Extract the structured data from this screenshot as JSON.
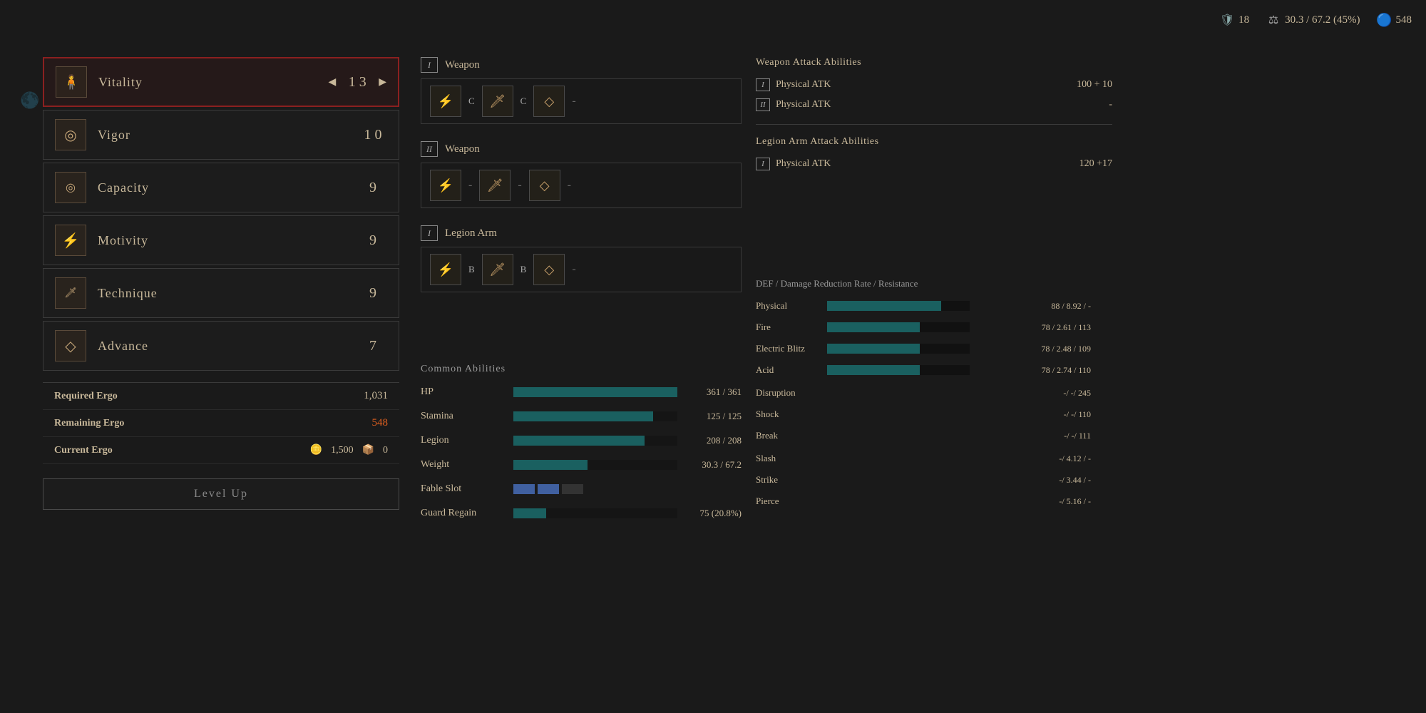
{
  "hud": {
    "shield_value": "18",
    "weight": "30.3 / 67.2 (45%)",
    "ergo": "548"
  },
  "left_decor": "☽",
  "stats": [
    {
      "id": "vitality",
      "name": "Vitality",
      "icon": "🧍",
      "value": "13",
      "selected": true,
      "showArrows": true
    },
    {
      "id": "vigor",
      "name": "Vigor",
      "icon": "◎",
      "value": "10",
      "selected": false,
      "showArrows": false
    },
    {
      "id": "capacity",
      "name": "Capacity",
      "icon": "◎",
      "value": "9",
      "selected": false,
      "showArrows": false
    },
    {
      "id": "motivity",
      "name": "Motivity",
      "icon": "⚡",
      "value": "9",
      "selected": false,
      "showArrows": false
    },
    {
      "id": "technique",
      "name": "Technique",
      "icon": "🗡",
      "value": "9",
      "selected": false,
      "showArrows": false
    },
    {
      "id": "advance",
      "name": "Advance",
      "icon": "◇",
      "value": "7",
      "selected": false,
      "showArrows": false
    }
  ],
  "ergo_info": {
    "required_label": "Required Ergo",
    "required_value": "1,031",
    "remaining_label": "Remaining Ergo",
    "remaining_value": "548",
    "current_label": "Current Ergo",
    "current_coins": "1,500",
    "current_chest": "0"
  },
  "level_up_label": "Level Up",
  "weapons": [
    {
      "roman": "I",
      "label": "Weapon",
      "slots": [
        {
          "icon": "⚡",
          "grade": "C"
        },
        {
          "icon": "🗡",
          "grade": "C"
        },
        {
          "icon": "◇",
          "grade": "-"
        }
      ]
    },
    {
      "roman": "II",
      "label": "Weapon",
      "slots": [
        {
          "icon": "⚡",
          "grade": "-"
        },
        {
          "icon": "🗡",
          "grade": "-"
        },
        {
          "icon": "◇",
          "grade": "-"
        }
      ]
    },
    {
      "roman": "I",
      "label": "Legion Arm",
      "slots": [
        {
          "icon": "⚡",
          "grade": "B"
        },
        {
          "icon": "🗡",
          "grade": "B"
        },
        {
          "icon": "◇",
          "grade": "-"
        }
      ]
    }
  ],
  "common_abilities": {
    "title": "Common Abilities",
    "items": [
      {
        "name": "HP",
        "bar_pct": 100,
        "value": "361 /  361"
      },
      {
        "name": "Stamina",
        "bar_pct": 85,
        "value": "125 /  125"
      },
      {
        "name": "Legion",
        "bar_pct": 80,
        "value": "208 /  208"
      },
      {
        "name": "Weight",
        "bar_pct": 45,
        "value": "30.3 /  67.2"
      },
      {
        "name": "Fable Slot",
        "bar_pct": 0,
        "value": "",
        "is_fable": true
      },
      {
        "name": "Guard Regain",
        "bar_pct": 20,
        "value": "75 (20.8%)"
      }
    ]
  },
  "weapon_attack": {
    "title": "Weapon Attack Abilities",
    "items": [
      {
        "roman": "I",
        "label": "Physical ATK",
        "value": "100 + 10"
      },
      {
        "roman": "II",
        "label": "Physical ATK",
        "value": "-"
      }
    ]
  },
  "legion_attack": {
    "title": "Legion Arm Attack Abilities",
    "items": [
      {
        "roman": "I",
        "label": "Physical ATK",
        "value": "120 +17"
      }
    ]
  },
  "defense": {
    "title": "DEF / Damage Reduction Rate / Resistance",
    "items": [
      {
        "name": "Physical",
        "bar_pct": 80,
        "value": "88 /  8.92 /  -"
      },
      {
        "name": "Fire",
        "bar_pct": 65,
        "value": "78 /  2.61 /  113"
      },
      {
        "name": "Electric Blitz",
        "bar_pct": 65,
        "value": "78 /  2.48 /  109"
      },
      {
        "name": "Acid",
        "bar_pct": 65,
        "value": "78 /  2.74 /  110"
      },
      {
        "name": "Disruption",
        "bar_pct": 0,
        "value": "-/      -/  245",
        "no_bar": true
      },
      {
        "name": "Shock",
        "bar_pct": 0,
        "value": "-/      -/  110",
        "no_bar": true
      },
      {
        "name": "Break",
        "bar_pct": 0,
        "value": "-/      -/  111",
        "no_bar": true
      },
      {
        "name": "Slash",
        "bar_pct": 0,
        "value": "-/  4.12 /  -",
        "no_bar": true
      },
      {
        "name": "Strike",
        "bar_pct": 0,
        "value": "-/  3.44 /  -",
        "no_bar": true
      },
      {
        "name": "Pierce",
        "bar_pct": 0,
        "value": "-/  5.16 /  -",
        "no_bar": true
      }
    ]
  }
}
